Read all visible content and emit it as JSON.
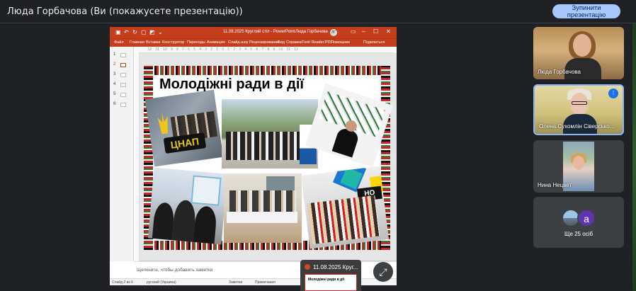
{
  "top_bar": {
    "presenter_text": "Люда Горбачова (Ви (покажусете презентацію))",
    "stop_button": "Зупинити презентацію"
  },
  "ppt": {
    "doc_title": "11.08.2025 Круглий стіл  -  PowerPoint",
    "user_name": "Люда Горбачова",
    "user_initials": "ЛГ",
    "menu": [
      "Файл",
      "Главная",
      "Вставка",
      "Конструктор",
      "Переходы",
      "Анимация",
      "Слайд-шоу",
      "Рецензирование",
      "Вид",
      "Справка",
      "Foxit Reader PDF",
      "Помощник",
      "Поделиться"
    ],
    "thumbnails": [
      "1",
      "2",
      "3",
      "4",
      "5",
      "6"
    ],
    "ruler": "· 12 · 11 · 10 · 9 · 8 · 7 · 6 · 5 · 4 · 3 · 2 · 1 · 0 · 1 · 2 · 3 · 4 · 5 · 6 · 7 · 8 · 9 · 10 · 11 · 12 ·",
    "slide_title": "Молодіжні ради в дії",
    "photo1_logo": "ЦНАП",
    "photo6_logo": "НО",
    "notes_placeholder": "Щелкните, чтобы добавить заметки",
    "status": {
      "slide": "Слайд 2 из 6",
      "language": "русский (Украина)",
      "notes": "Заметки",
      "comments": "Примечания"
    }
  },
  "meet_popup": {
    "title": "11.08.2025 Круг...",
    "thumb_title": "Молодіжні ради в дії"
  },
  "participants": [
    {
      "name": "Люда Горбачова"
    },
    {
      "name": "Олена Сухомлін Сіверсько..."
    },
    {
      "name": "Нина Нецвет"
    }
  ],
  "others": {
    "initial": "a",
    "label": "Ще 25 осіб"
  },
  "colors": {
    "ppt_accent": "#c43e1c",
    "meet_bg": "#202124",
    "button": "#a8c7fa"
  }
}
